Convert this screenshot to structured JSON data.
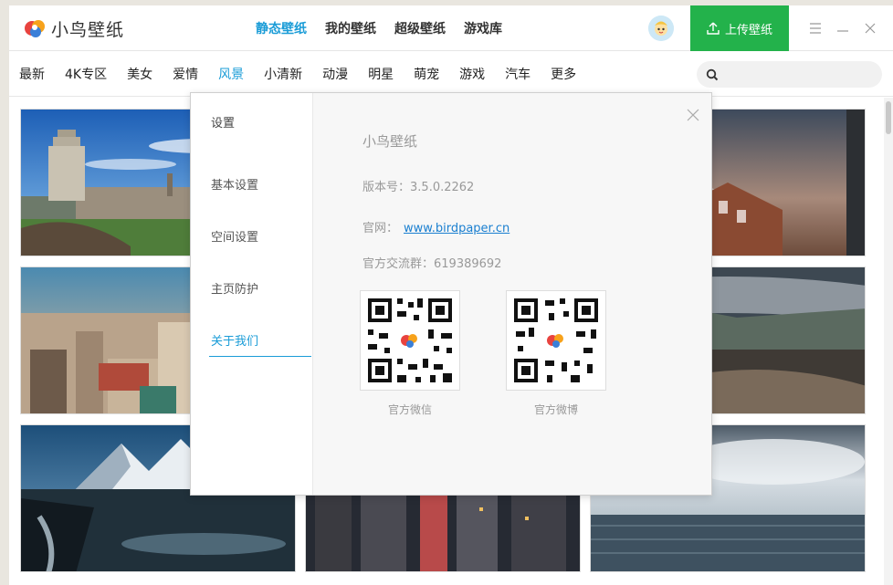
{
  "app": {
    "logo_text": "小鸟壁纸"
  },
  "topnav": [
    {
      "label": "静态壁纸",
      "active": true
    },
    {
      "label": "我的壁纸",
      "active": false
    },
    {
      "label": "超级壁纸",
      "active": false
    },
    {
      "label": "游戏库",
      "active": false
    }
  ],
  "upload_label": "上传壁纸",
  "categories": [
    {
      "label": "最新"
    },
    {
      "label": "4K专区"
    },
    {
      "label": "美女"
    },
    {
      "label": "爱情"
    },
    {
      "label": "风景",
      "active": true
    },
    {
      "label": "小清新"
    },
    {
      "label": "动漫"
    },
    {
      "label": "明星"
    },
    {
      "label": "萌宠"
    },
    {
      "label": "游戏"
    },
    {
      "label": "汽车"
    },
    {
      "label": "更多"
    }
  ],
  "search": {
    "placeholder": ""
  },
  "settings": {
    "title": "设置",
    "items": [
      {
        "label": "基本设置"
      },
      {
        "label": "空间设置"
      },
      {
        "label": "主页防护"
      },
      {
        "label": "关于我们",
        "active": true
      }
    ]
  },
  "about": {
    "app_name": "小鸟壁纸",
    "version_label": "版本号：",
    "version": "3.5.0.2262",
    "site_label": "官网：",
    "site_url": "www.birdpaper.cn",
    "group_label": "官方交流群：",
    "group_number": "619389692",
    "qr_wechat_caption": "官方微信",
    "qr_weibo_caption": "官方微博"
  },
  "colors": {
    "accent": "#1a9cd7",
    "upload": "#23b24b"
  },
  "thumbnails": [
    {
      "name": "edinburgh-monument",
      "theme": "city-sky"
    },
    {
      "name": "city-sunset",
      "theme": "sunset"
    },
    {
      "name": "rooftops-city",
      "theme": "city"
    },
    {
      "name": "red-cabins-coast",
      "theme": "coast"
    },
    {
      "name": "snowy-mountains",
      "theme": "mountain"
    },
    {
      "name": "night-skyscrapers",
      "theme": "night"
    },
    {
      "name": "cloudy-sea",
      "theme": "sea"
    }
  ]
}
